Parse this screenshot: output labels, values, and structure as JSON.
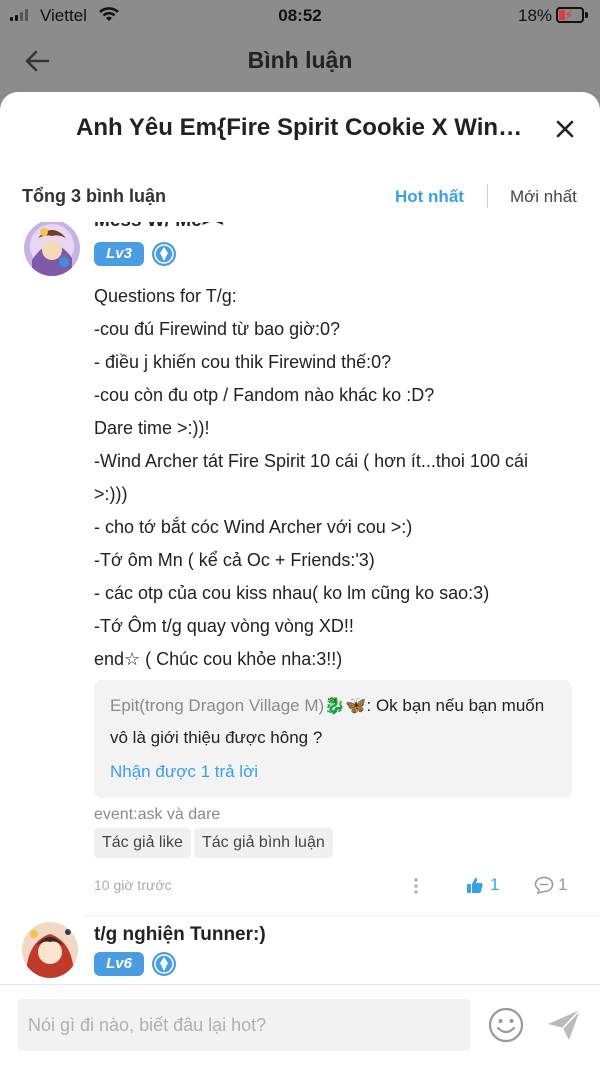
{
  "status_bar": {
    "carrier": "Viettel",
    "time": "08:52",
    "battery": "18%",
    "battery_level": 0.18,
    "icons": [
      "signal-icon",
      "wifi-icon",
      "battery-charging-icon"
    ]
  },
  "header": {
    "title": "Bình luận",
    "back_icon": "arrow-left-icon"
  },
  "sheet": {
    "title": "Anh Yêu Em{Fire Spirit Cookie X Wind Archer Cookie}",
    "close_icon": "close-icon"
  },
  "comments_bar": {
    "count_label": "Tổng 3 bình luận",
    "sort_hot": "Hot nhất",
    "sort_new": "Mới nhất"
  },
  "comments": [
    {
      "username": "Mess W/ Me><",
      "level": "Lv3",
      "badge_icon": "shield-icon",
      "lines": [
        "Questions for T/g:",
        "-cou đú Firewind từ bao giờ:0?",
        "- điều j khiến cou thik Firewind thế:0?",
        "-cou còn đu otp / Fandom nào khác ko :D?",
        "Dare time >:))!",
        "-Wind Archer tát Fire Spirit 10 cái ( hơn ít...thoi 100 cái",
        ">:)))",
        "- cho tớ bắt cóc Wind Archer với cou >:)",
        "-Tớ ôm Mn ( kể cả Oc + Friends:'3)",
        "- các otp của cou kiss nhau( ko lm cũng ko sao:3)",
        "-Tớ Ôm t/g quay vòng vòng XD!!",
        "end☆ ( Chúc cou khỏe nha:3!!)"
      ],
      "reply": {
        "author": "Epit(trong Dragon Village M)🐉🦋",
        "text": ": Ok bạn nếu bạn muốn vô là giới thiệu được hông ?",
        "more": "Nhận được 1 trả lời"
      },
      "event": "event:ask và dare",
      "tags": [
        "Tác giả like",
        "Tác giả bình luận"
      ],
      "time": "10 giờ trước",
      "likes": "1",
      "replies": "1"
    },
    {
      "username": "t/g nghiện Tunner:)",
      "level": "Lv6",
      "badge_icon": "shield-icon"
    }
  ],
  "input": {
    "placeholder": "Nói gì đi nào, biết đâu lại hot?",
    "emoji_icon": "smiley-icon",
    "send_icon": "send-icon"
  },
  "colors": {
    "accent": "#3aa0e8",
    "level_badge": "#4a9de3",
    "overlay": "#8c8c8c"
  }
}
